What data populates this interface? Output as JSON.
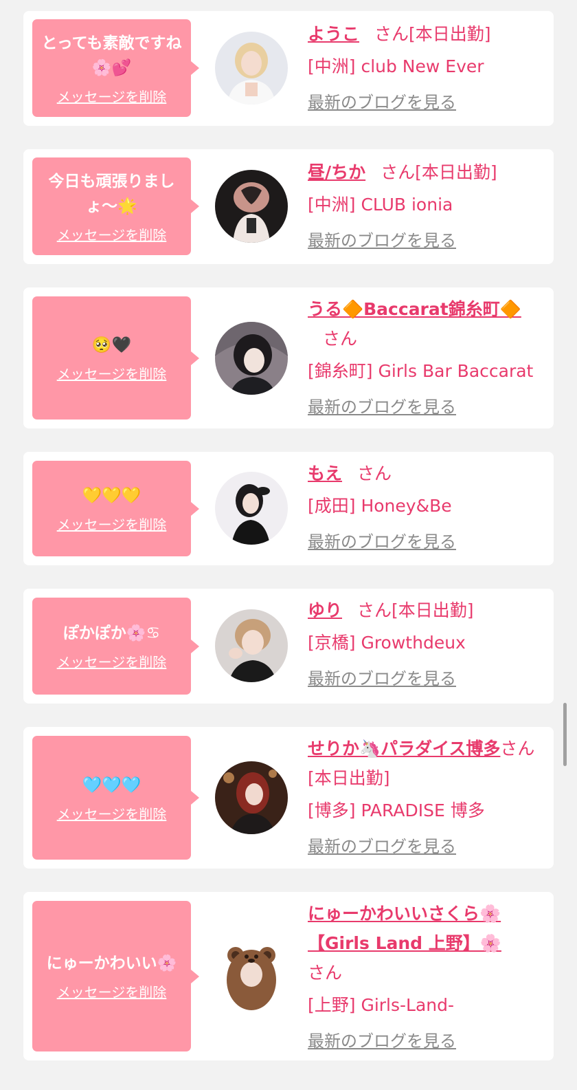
{
  "delete_label": "メッセージを削除",
  "san": "さん",
  "blog_label": "最新のブログを見る",
  "accent_color": "#e83a6c",
  "bubble_color": "#ff97a7",
  "cards": [
    {
      "message": "とっても素敵ですね🌸💕",
      "name": "ようこ",
      "status": "[本日出勤]",
      "shop": "[中洲] club New Ever",
      "avatar_icon": "woman-blonde-avatar-icon"
    },
    {
      "message": "今日も頑張りましょ〜🌟",
      "name": "昼/ちか",
      "status": "[本日出勤]",
      "shop": "[中洲] CLUB ionia",
      "avatar_icon": "woman-heart-hands-avatar-icon"
    },
    {
      "message": "🥺🖤",
      "name": "うる🔶Baccarat錦糸町🔶",
      "status": "",
      "shop": "[錦糸町] Girls Bar Baccarat",
      "avatar_icon": "woman-dark-hair-avatar-icon"
    },
    {
      "message": "💛💛💛",
      "name": "もえ",
      "status": "",
      "shop": "[成田] Honey&Be",
      "avatar_icon": "woman-black-dress-avatar-icon"
    },
    {
      "message": "ぽかぽか🌸♋",
      "name": "ゆり",
      "status": "[本日出勤]",
      "shop": "[京橋] Growthdeux",
      "avatar_icon": "woman-selfie-avatar-icon"
    },
    {
      "message": "🩵🩵🩵",
      "name": "せりか🦄パラダイス博多",
      "status": "[本日出勤]",
      "shop": "[博多] PARADISE 博多",
      "avatar_icon": "woman-red-hair-avatar-icon"
    },
    {
      "message": "にゅーかわいい🌸",
      "name": "にゅーかわいいさくら🌸【Girls Land 上野】🌸",
      "status": "",
      "shop": "[上野] Girls-Land-",
      "avatar_icon": "bear-costume-avatar-icon"
    }
  ]
}
